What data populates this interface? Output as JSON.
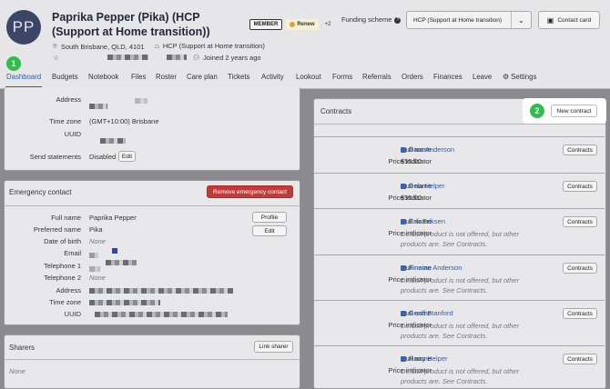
{
  "header": {
    "avatar_initials": "PP",
    "title": "Paprika Pepper (Pika) (HCP (Support at Home transition))",
    "member_badge": "MEMBER",
    "renew_badge": "Renew",
    "extra_badge": "+2",
    "location": "South Brisbane, QLD, 4101",
    "plan": "HCP (Support at Home transition)",
    "joined": "Joined 2 years ago",
    "funding_label": "Funding scheme",
    "funding_value": "HCP (Support at Home transition)",
    "contact_card": "Contact card"
  },
  "tabs": [
    "Dashboard",
    "Budgets",
    "Notebook",
    "Files",
    "Roster",
    "Care plan",
    "Tickets",
    "Activity",
    "Lookout",
    "Forms",
    "Referrals",
    "Orders",
    "Finances",
    "Leave",
    "Settings"
  ],
  "details": {
    "address_label": "Address",
    "timezone_label": "Time zone",
    "timezone_value": "(GMT+10:00) Brisbane",
    "uuid_label": "UUID",
    "send_statements_label": "Send statements",
    "send_statements_value": "Disabled",
    "edit": "Edit"
  },
  "emergency": {
    "title": "Emergency contact",
    "remove_button": "Remove emergency contact",
    "full_name_label": "Full name",
    "full_name_value": "Paprika Pepper",
    "preferred_name_label": "Preferred name",
    "preferred_name_value": "Pika",
    "dob_label": "Date of birth",
    "dob_value": "None",
    "email_label": "Email",
    "tel1_label": "Telephone 1",
    "tel2_label": "Telephone 2",
    "tel2_value": "None",
    "address_label": "Address",
    "timezone_label": "Time zone",
    "uuid_label": "UUID",
    "profile_button": "Profile",
    "edit_button": "Edit"
  },
  "sharers": {
    "title": "Sharers",
    "link_button": "Link sharer",
    "none": "None"
  },
  "contracts": {
    "title": "Contracts",
    "new_button": "New contract",
    "full_name_label": "Full name",
    "price_label": "Price indicator",
    "contracts_button": "Contracts",
    "items": [
      {
        "name": "Dara Anderson",
        "price": "$55.00",
        "note": ""
      },
      {
        "name": "Dela Helper",
        "price": "$55.00",
        "note": ""
      },
      {
        "name": "Erik Eriksen",
        "price": "",
        "note": "Default product is not offered, but other products are. See Contracts."
      },
      {
        "name": "Finnian Anderson",
        "price": "",
        "note": "Default product is not offered, but other products are. See Contracts."
      },
      {
        "name": "Geoff Stanford",
        "price": "",
        "note": "Default product is not offered, but other products are. See Contracts."
      },
      {
        "name": "Harry Helper",
        "price": "",
        "note": "Default product is not offered, but other products are. See Contracts."
      }
    ]
  },
  "callouts": [
    "1",
    "2"
  ]
}
